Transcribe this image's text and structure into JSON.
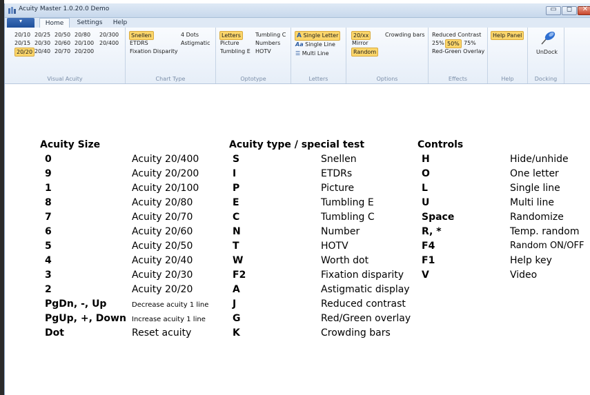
{
  "window": {
    "title": "Acuity Master 1.0.20.0 Demo",
    "controls": {
      "min": "▭",
      "max": "◻",
      "close": "✕"
    }
  },
  "tabs": [
    "Home",
    "Settings",
    "Help"
  ],
  "ribbon": {
    "visual_acuity": {
      "caption": "Visual Acuity",
      "rows": [
        [
          "20/10",
          "20/25",
          "20/50",
          "20/80",
          "20/300"
        ],
        [
          "20/15",
          "20/30",
          "20/60",
          "20/100",
          "20/400"
        ],
        [
          "20/20",
          "20/40",
          "20/70",
          "20/200"
        ]
      ]
    },
    "chart_type": {
      "caption": "Chart Type",
      "items": [
        "Snellen",
        "4 Dots",
        "ETDRS",
        "Astigmatic",
        "Fixation Disparity"
      ]
    },
    "optotype": {
      "caption": "Optotype",
      "items": [
        "Letters",
        "Tumbling C",
        "Picture",
        "Numbers",
        "Tumbling E",
        "HOTV"
      ]
    },
    "letters": {
      "caption": "Letters",
      "items": [
        "Single Letter",
        "Single Line",
        "Multi Line"
      ]
    },
    "options": {
      "caption": "Options",
      "items": [
        "20/xx",
        "Crowding bars",
        "Mirror",
        "Random"
      ]
    },
    "effects": {
      "caption": "Effects",
      "items": [
        "Reduced Contrast",
        "25%",
        "50%",
        "75%",
        "Red-Green Overlay"
      ]
    },
    "help": {
      "caption": "Help",
      "button": "Help Panel"
    },
    "docking": {
      "caption": "Docking",
      "button": "UnDock"
    }
  },
  "content": {
    "acuity": {
      "header": "Acuity Size",
      "rows": [
        [
          "0",
          "Acuity 20/400"
        ],
        [
          "9",
          "Acuity 20/200"
        ],
        [
          "1",
          "Acuity 20/100"
        ],
        [
          "8",
          "Acuity 20/80"
        ],
        [
          "7",
          "Acuity 20/70"
        ],
        [
          "6",
          "Acuity 20/60"
        ],
        [
          "5",
          "Acuity 20/50"
        ],
        [
          "4",
          "Acuity 20/40"
        ],
        [
          "3",
          "Acuity 20/30"
        ],
        [
          "2",
          "Acuity 20/20"
        ],
        [
          "PgDn, -, Up",
          "Decrease acuity 1 line"
        ],
        [
          "PgUp, +, Down",
          "Increase acuity 1 line"
        ],
        [
          "Dot",
          "Reset acuity"
        ]
      ]
    },
    "type": {
      "header": "Acuity type / special test",
      "rows": [
        [
          "S",
          "Snellen"
        ],
        [
          "I",
          "ETDRs"
        ],
        [
          "P",
          "Picture"
        ],
        [
          "E",
          "Tumbling E"
        ],
        [
          "C",
          "Tumbling C"
        ],
        [
          "N",
          "Number"
        ],
        [
          "T",
          "HOTV"
        ],
        [
          "W",
          "Worth dot"
        ],
        [
          "F2",
          "Fixation disparity"
        ],
        [
          "A",
          "Astigmatic display"
        ],
        [
          "J",
          "Reduced contrast"
        ],
        [
          "G",
          "Red/Green overlay"
        ],
        [
          "K",
          "Crowding bars"
        ]
      ]
    },
    "controls": {
      "header": "Controls",
      "rows": [
        [
          "H",
          "Hide/unhide"
        ],
        [
          "O",
          "One letter"
        ],
        [
          "L",
          "Single line"
        ],
        [
          "U",
          "Multi line"
        ],
        [
          "Space",
          "Randomize"
        ],
        [
          "R, *",
          "Temp. random"
        ],
        [
          "F4",
          "Random ON/OFF"
        ],
        [
          "F1",
          "Help key"
        ],
        [
          "V",
          "Video"
        ]
      ]
    }
  }
}
